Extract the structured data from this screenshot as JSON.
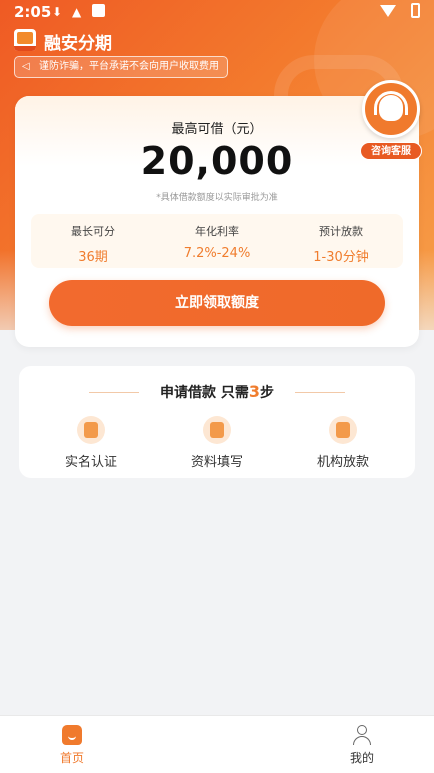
{
  "status_bar": {
    "time": "2:05"
  },
  "app": {
    "name": "融安分期"
  },
  "notice": {
    "text": "谨防诈骗，平台承诺不会向用户收取费用"
  },
  "customer_service": {
    "label": "咨询客服"
  },
  "loan_card": {
    "title": "最高可借（元）",
    "amount": "20,000",
    "note": "*具体借款额度以实际审批为准",
    "info": [
      {
        "label": "最长可分",
        "value": "36期"
      },
      {
        "label": "年化利率",
        "value": "7.2%-24%"
      },
      {
        "label": "预计放款",
        "value": "1-30分钟"
      }
    ],
    "button_label": "立即领取额度"
  },
  "steps": {
    "title_prefix": "申请借款 只需",
    "count": "3",
    "title_suffix": "步",
    "items": [
      {
        "label": "实名认证",
        "icon": "user-verify-icon"
      },
      {
        "label": "资料填写",
        "icon": "form-edit-icon"
      },
      {
        "label": "机构放款",
        "icon": "money-down-icon"
      }
    ]
  },
  "tabbar": {
    "items": [
      {
        "label": "首页",
        "icon": "home-icon",
        "active": true
      },
      {
        "label": "我的",
        "icon": "profile-icon",
        "active": false
      }
    ]
  },
  "colors": {
    "accent": "#f07a2d",
    "value_orange": "#f07d2e",
    "hero_start": "#ef5a24",
    "hero_end": "#f7a04a"
  }
}
